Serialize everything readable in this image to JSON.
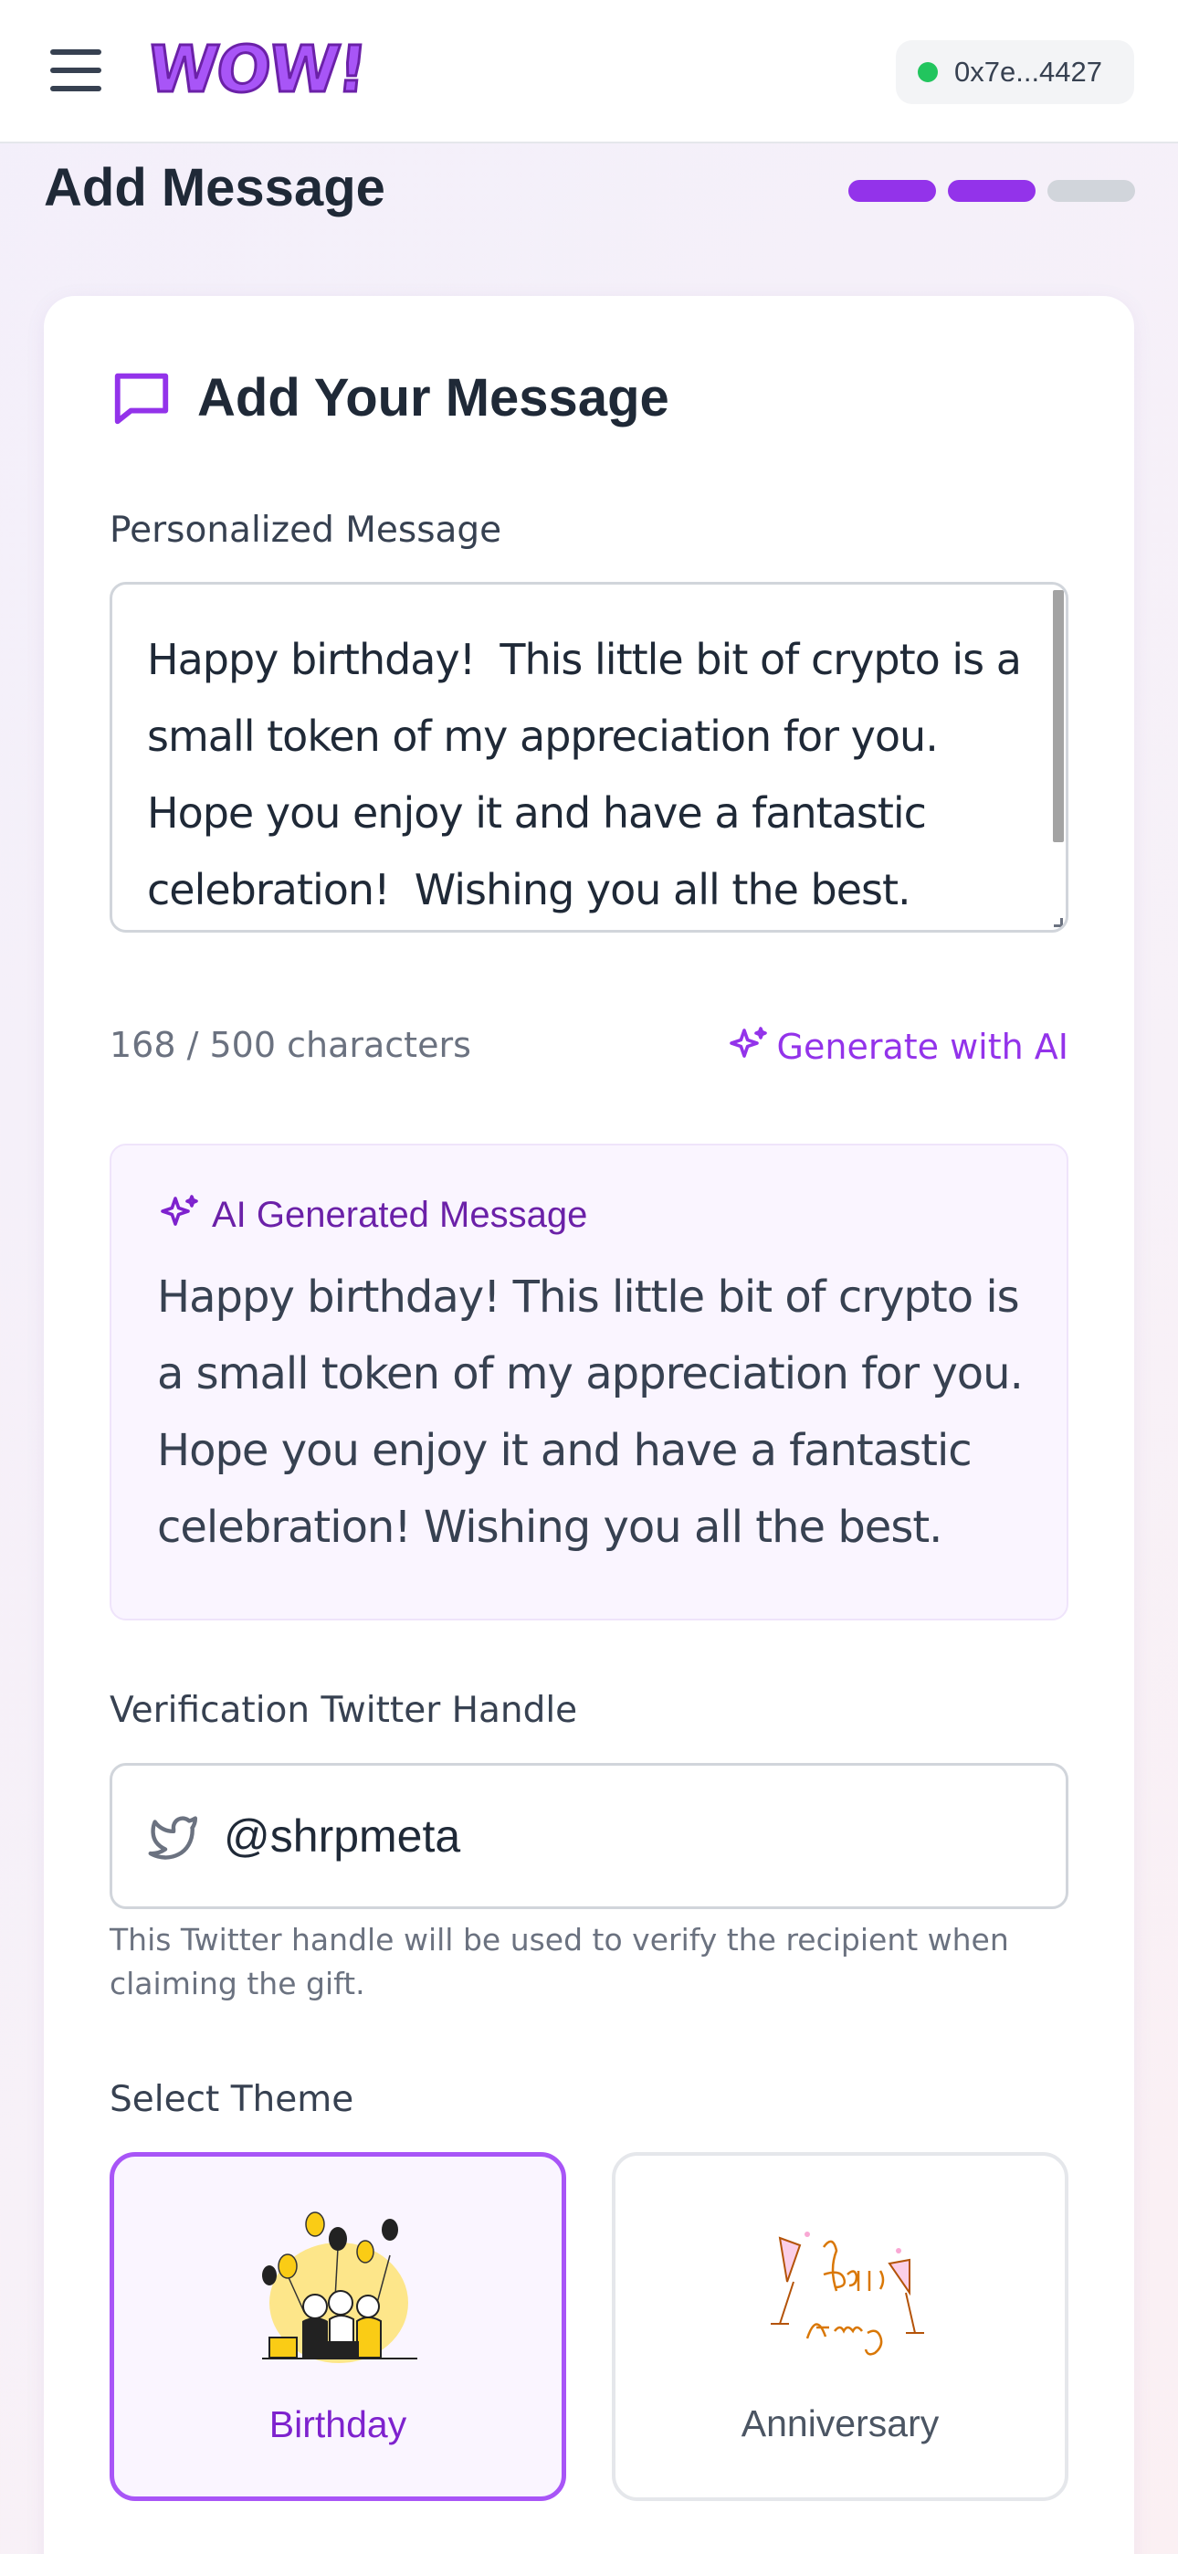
{
  "header": {
    "logo_text": "WOW!",
    "wallet_address": "0x7e...4427",
    "wallet_status_color": "#22c55e"
  },
  "page": {
    "title": "Add Message",
    "steps_completed": 2,
    "steps_total": 3
  },
  "card": {
    "title": "Add Your Message",
    "message_label": "Personalized Message",
    "message_value": "Happy birthday!  This little bit of crypto is a small token of my appreciation for you.  Hope you enjoy it and have a fantastic celebration!  Wishing you all the best.",
    "char_count": "168 / 500 characters",
    "generate_ai_label": "Generate with AI",
    "ai_box": {
      "title": "AI Generated Message",
      "text": "Happy birthday! This little bit of crypto is a small token of my appreciation for you. Hope you enjoy it and have a fantastic celebration! Wishing you all the best."
    },
    "twitter_label": "Verification Twitter Handle",
    "twitter_value": "@shrpmeta",
    "twitter_help": "This Twitter handle will be used to verify the recipient when claiming the gift.",
    "theme_label": "Select Theme",
    "themes": [
      {
        "label": "Birthday",
        "selected": true
      },
      {
        "label": "Anniversary",
        "selected": false
      }
    ]
  },
  "colors": {
    "accent": "#9333ea",
    "accent_light": "#faf5ff",
    "progress_off": "#d1d5db"
  }
}
